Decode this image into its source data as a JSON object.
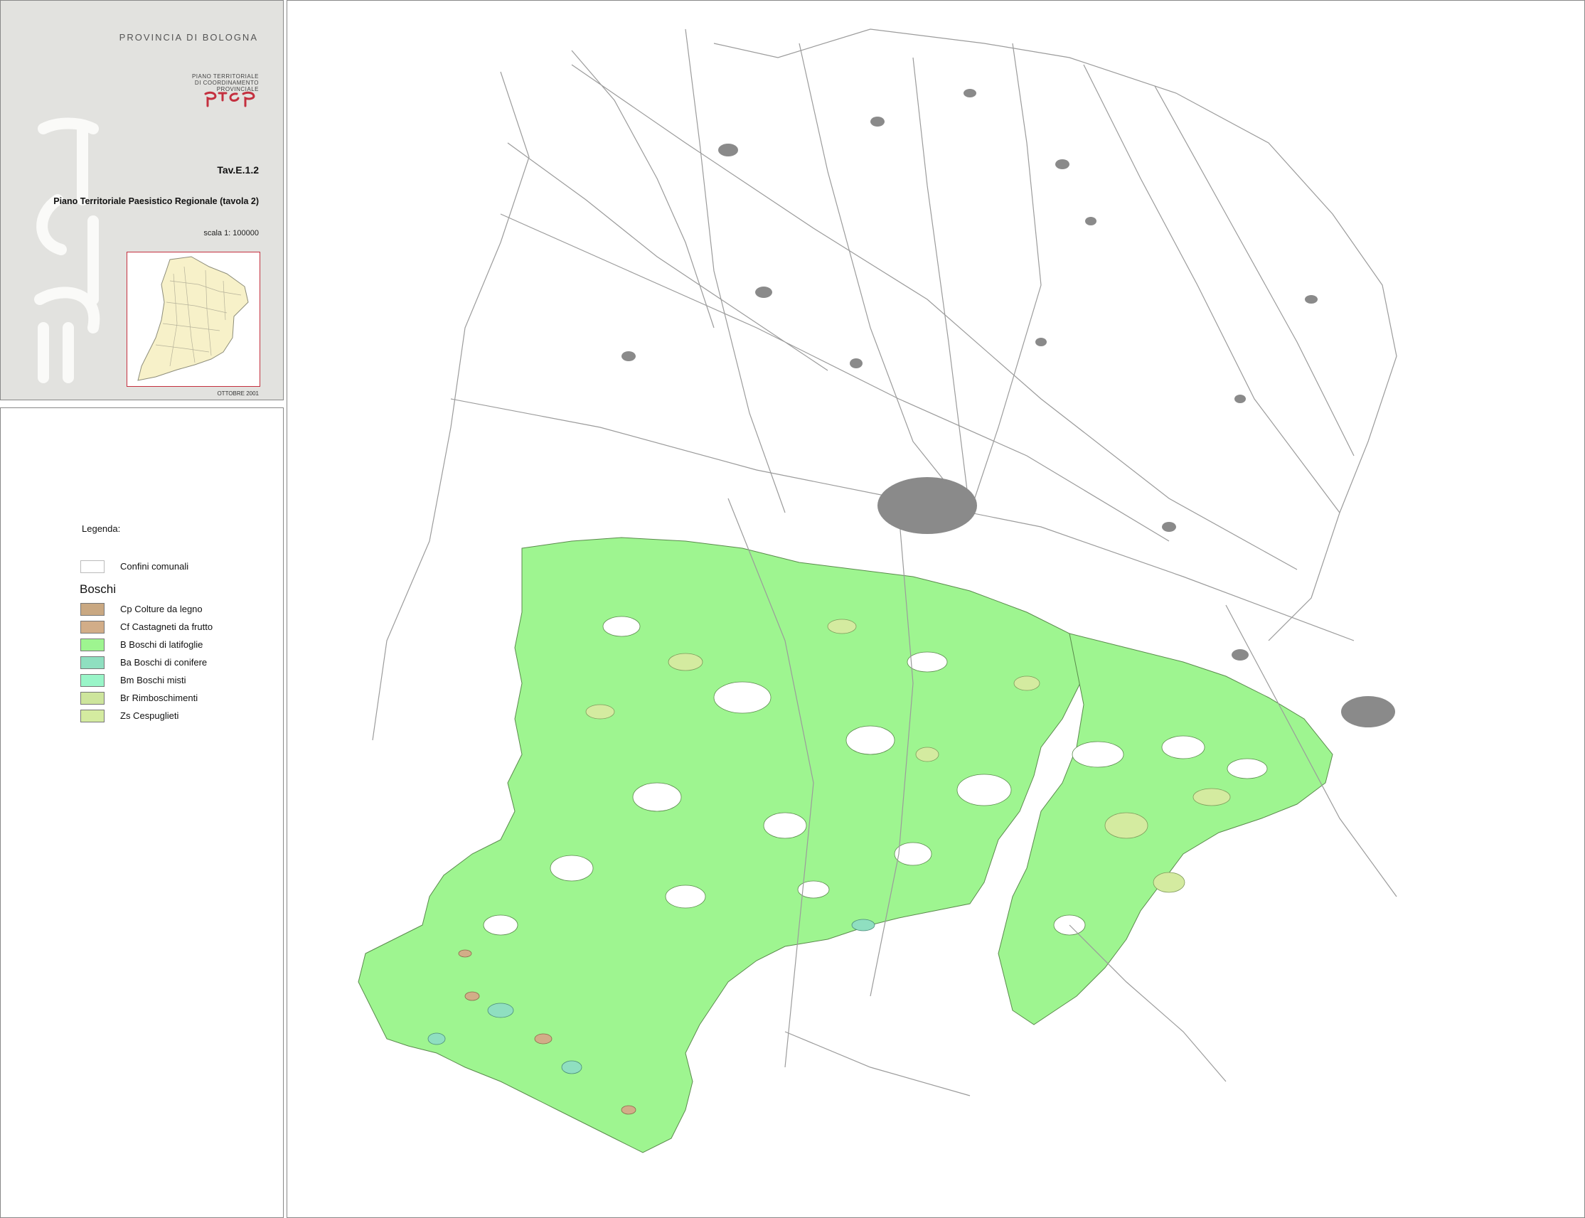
{
  "header": {
    "province": "PROVINCIA DI BOLOGNA",
    "logo_lines": [
      "PIANO TERRITORIALE",
      "DI COORDINAMENTO",
      "PROVINCIALE"
    ],
    "logo_mark": "ptcp",
    "table_id": "Tav.E.1.2",
    "plan_title": "Piano Territoriale Paesistico Regionale (tavola 2)",
    "scale": "scala 1: 100000",
    "date": "OTTOBRE 2001"
  },
  "legend": {
    "heading": "Legenda:",
    "boundary": {
      "label": "Confini comunali",
      "color": "#ffffff"
    },
    "group_title": "Boschi",
    "items": [
      {
        "label": "Cp Colture da legno",
        "color": "#c9a882"
      },
      {
        "label": "Cf Castagneti da frutto",
        "color": "#d2ad88"
      },
      {
        "label": "B Boschi di latifoglie",
        "color": "#9ef590"
      },
      {
        "label": "Ba Boschi di conifere",
        "color": "#8fdfc0"
      },
      {
        "label": "Bm Boschi misti",
        "color": "#99f5c8"
      },
      {
        "label": "Br Rimboschimenti",
        "color": "#cde59c"
      },
      {
        "label": "Zs Cespuglieti",
        "color": "#d4eba0"
      }
    ]
  },
  "map": {
    "background": "#ffffff",
    "road_color": "#9b9b9b",
    "urban_color": "#8a8a8a",
    "forest_color": "#9ef590"
  }
}
